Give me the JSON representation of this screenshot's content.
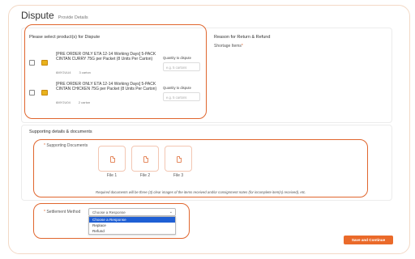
{
  "page": {
    "title": "Dispute",
    "subtitle": "Provide Details"
  },
  "products_section": {
    "heading": "Please select product(s) for Dispute",
    "items": [
      {
        "name": "[PRE ORDER ONLY ETA 12-14 Working Days] 5-PACK CINTAN CURRY 75G per Packet (8 Units Per Carton)",
        "sku": "6MY2UU4",
        "qty_text": "3 carton",
        "qty_label": "Quantity to dispute",
        "qty_placeholder": "e.g. 5 cartons"
      },
      {
        "name": "[PRE ORDER ONLY ETA 12-14 Working Days] 5-PACK CINTAN CHICKEN 75G per Packet (8 Units Per Carton)",
        "sku": "6MY2U04",
        "qty_text": "2 carton",
        "qty_label": "Quantity to dispute",
        "qty_placeholder": "e.g. 5 cartons"
      }
    ]
  },
  "reason_section": {
    "heading": "Reason for Return & Refund",
    "field_label": "Shortage Items",
    "required_mark": "*"
  },
  "supporting_section": {
    "heading": "Supporting details & documents",
    "docs_label": "Supporting Documents",
    "required_mark": "*",
    "files": [
      "File 1",
      "File 2",
      "File 3"
    ],
    "note": "Required documents will be three (3) clear images of the items received and/or consignment notes (for incomplete item(s) received), etc."
  },
  "settlement": {
    "label": "Settlement Method",
    "required_mark": "*",
    "selected": "Choose a Response",
    "options": [
      "Choose a Response",
      "Replace",
      "Refund"
    ]
  },
  "actions": {
    "save_label": "Save and Continue"
  },
  "colors": {
    "accent": "#ea6a2a",
    "highlight_border": "#e0662e",
    "option_selected": "#1f5fd4"
  }
}
